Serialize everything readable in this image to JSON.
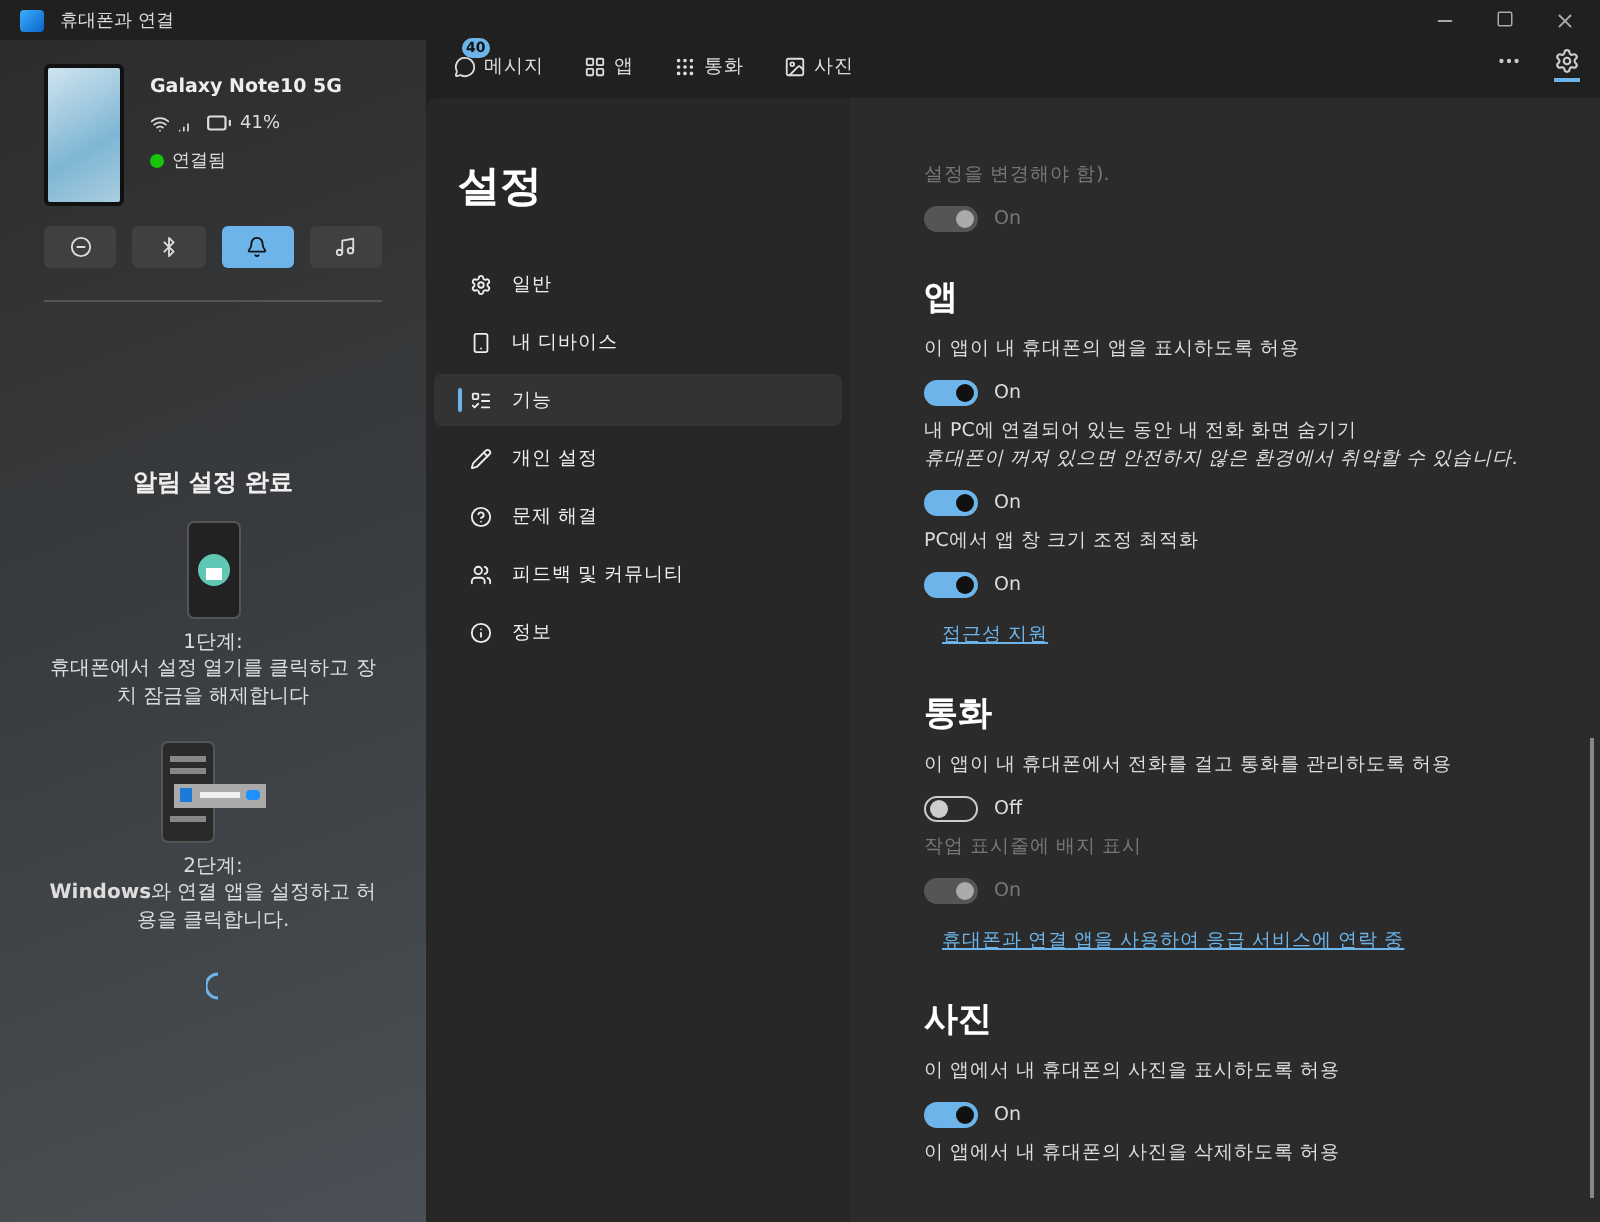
{
  "window": {
    "title": "휴대폰과 연결"
  },
  "device": {
    "name": "Galaxy Note10 5G",
    "battery": "41%",
    "status": "연결됨",
    "connected": true
  },
  "quick_actions": [
    {
      "selected": false
    },
    {
      "selected": false
    },
    {
      "selected": true
    },
    {
      "selected": false
    }
  ],
  "notice": {
    "title": "알림 설정 완료",
    "steps": [
      {
        "label": "1단계:",
        "text": "휴대폰에서 설정 열기를 클릭하고 장치 잠금을 해제합니다"
      },
      {
        "label": "2단계:",
        "text": "**Windows**와 연결 앱을 설정하고 허용을 클릭합니다."
      }
    ]
  },
  "tabs": [
    {
      "label": "메시지",
      "badge": "40",
      "selected": false
    },
    {
      "label": "앱",
      "selected": false
    },
    {
      "label": "통화",
      "selected": false
    },
    {
      "label": "사진",
      "selected": false
    }
  ],
  "settings_button": {
    "selected": true
  },
  "settings_nav": {
    "title": "설정",
    "items": [
      {
        "label": "일반",
        "selected": false
      },
      {
        "label": "내 디바이스",
        "selected": false
      },
      {
        "label": "기능",
        "selected": true
      },
      {
        "label": "개인 설정",
        "selected": false
      },
      {
        "label": "문제 해결",
        "selected": false
      },
      {
        "label": "피드백 및 커뮤니티",
        "selected": false
      },
      {
        "label": "정보",
        "selected": false
      }
    ]
  },
  "sections": [
    {
      "items": [
        {
          "kind": "label",
          "text": "설정을 변경해야 함).",
          "disabled": true
        },
        {
          "kind": "toggle",
          "on": true,
          "disabled": true,
          "text": "On"
        }
      ]
    },
    {
      "heading": "앱",
      "items": [
        {
          "kind": "label",
          "text": "이 앱이 내 휴대폰의 앱을 표시하도록 허용",
          "disabled": false
        },
        {
          "kind": "toggle",
          "on": true,
          "disabled": false,
          "text": "On"
        },
        {
          "kind": "label",
          "text": "내 PC에 연결되어 있는 동안 내 전화 화면 숨기기",
          "disabled": false
        },
        {
          "kind": "note",
          "text": "휴대폰이 꺼져 있으면 안전하지 않은 환경에서 취약할 수 있습니다."
        },
        {
          "kind": "toggle",
          "on": true,
          "disabled": false,
          "text": "On"
        },
        {
          "kind": "label",
          "text": "PC에서 앱 창 크기 조정 최적화",
          "disabled": false
        },
        {
          "kind": "toggle",
          "on": true,
          "disabled": false,
          "text": "On"
        },
        {
          "kind": "link",
          "text": "접근성 지원"
        }
      ]
    },
    {
      "heading": "통화",
      "items": [
        {
          "kind": "label",
          "text": "이 앱이 내 휴대폰에서 전화를 걸고 통화를 관리하도록 허용",
          "disabled": false
        },
        {
          "kind": "toggle",
          "on": false,
          "disabled": false,
          "text": "Off"
        },
        {
          "kind": "label",
          "text": "작업 표시줄에 배지 표시",
          "disabled": true
        },
        {
          "kind": "toggle",
          "on": true,
          "disabled": true,
          "text": "On"
        },
        {
          "kind": "link",
          "text": "휴대폰과 연결 앱을 사용하여 응급 서비스에 연락 중"
        }
      ]
    },
    {
      "heading": "사진",
      "items": [
        {
          "kind": "label",
          "text": "이 앱에서 내 휴대폰의 사진을 표시하도록 허용",
          "disabled": false
        },
        {
          "kind": "toggle",
          "on": true,
          "disabled": false,
          "text": "On"
        },
        {
          "kind": "label",
          "text": "이 앱에서 내 휴대폰의 사진을 삭제하도록 허용",
          "disabled": false
        }
      ]
    }
  ]
}
